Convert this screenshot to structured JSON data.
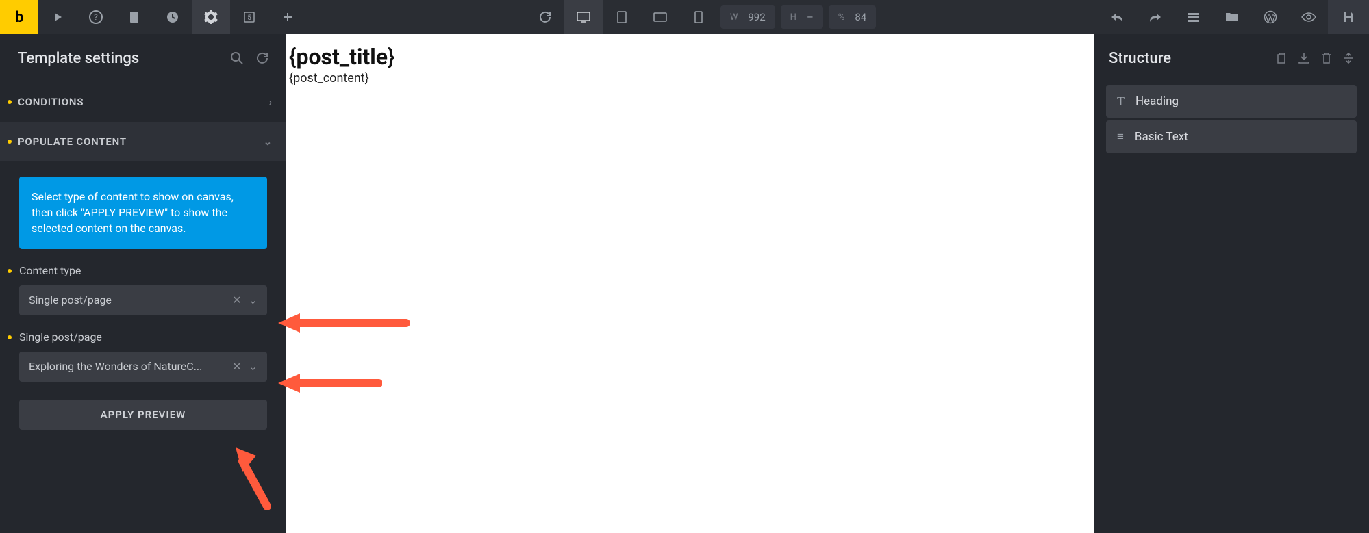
{
  "topbar": {
    "logo": "b",
    "dims": {
      "w_label": "W",
      "w_value": "992",
      "h_label": "H",
      "h_value": "–",
      "pct_label": "%",
      "pct_value": "84"
    }
  },
  "left": {
    "title": "Template settings",
    "sections": {
      "conditions": "CONDITIONS",
      "populate": "POPULATE CONTENT"
    },
    "info": "Select type of content to show on canvas, then click \"APPLY PREVIEW\" to show the selected content on the canvas.",
    "content_type_label": "Content type",
    "content_type_value": "Single post/page",
    "single_post_label": "Single post/page",
    "single_post_value": "Exploring the Wonders of NatureC...",
    "apply_btn": "APPLY PREVIEW"
  },
  "canvas": {
    "title": "{post_title}",
    "body": "{post_content}"
  },
  "right": {
    "title": "Structure",
    "items": [
      {
        "icon": "T",
        "label": "Heading"
      },
      {
        "icon": "≡",
        "label": "Basic Text"
      }
    ]
  }
}
